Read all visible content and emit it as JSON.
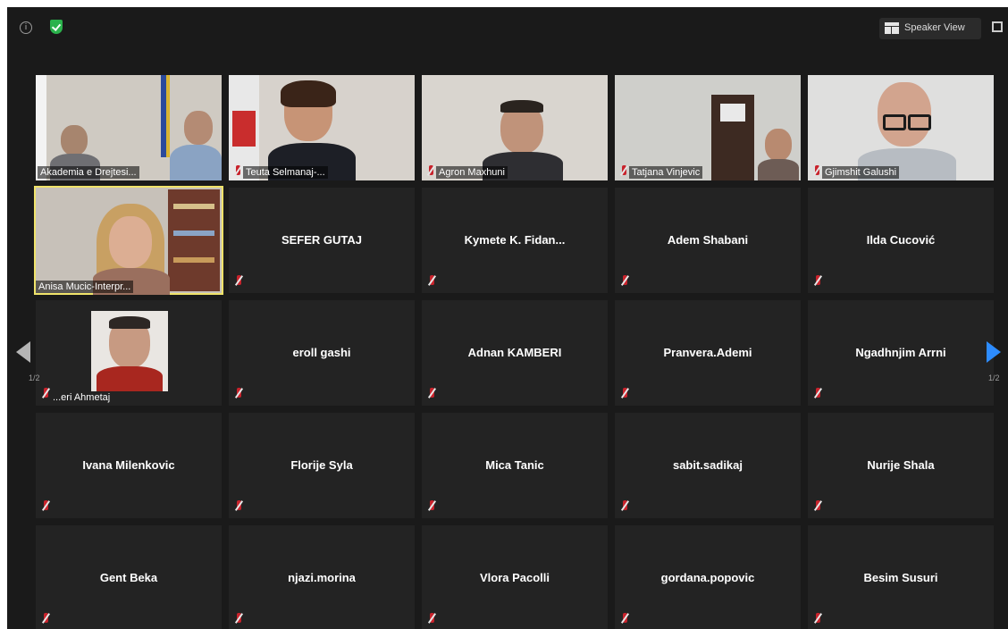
{
  "toolbar": {
    "info_icon": "info-icon",
    "security_icon": "shield-check-icon",
    "speaker_view_label": "Speaker View",
    "fullscreen_icon": "fullscreen-icon"
  },
  "pager": {
    "left_indicator": "1/2",
    "right_indicator": "1/2"
  },
  "video_participants": [
    {
      "name": "Akademia e Drejtesi..."
    },
    {
      "name": "Teuta Selmanaj-..."
    },
    {
      "name": "Agron Maxhuni"
    },
    {
      "name": "Tatjana Vinjevic"
    },
    {
      "name": "Gjimshit Galushi"
    },
    {
      "name": "Anisa Mucic-Interpr..."
    },
    {
      "name": "...eri Ahmetaj"
    }
  ],
  "participants": [
    {
      "name": "SEFER GUTAJ"
    },
    {
      "name": "Kymete K. Fidan..."
    },
    {
      "name": "Adem Shabani"
    },
    {
      "name": "Ilda Cucović"
    },
    {
      "name": "eroll gashi"
    },
    {
      "name": "Adnan KAMBERI"
    },
    {
      "name": "Pranvera.Ademi"
    },
    {
      "name": "Ngadhnjim Arrni"
    },
    {
      "name": "Ivana Milenkovic"
    },
    {
      "name": "Florije Syla"
    },
    {
      "name": "Mica Tanic"
    },
    {
      "name": "sabit.sadikaj"
    },
    {
      "name": "Nurije Shala"
    },
    {
      "name": "Gent Beka"
    },
    {
      "name": "njazi.morina"
    },
    {
      "name": "Vlora Pacolli"
    },
    {
      "name": "gordana.popovic"
    },
    {
      "name": "Besim Susuri"
    }
  ],
  "colors": {
    "background": "#1a1a1a",
    "tile": "#232323",
    "active_speaker_border": "#f0e36a",
    "muted_icon": "#c8232c",
    "next_arrow": "#2d8cff"
  }
}
